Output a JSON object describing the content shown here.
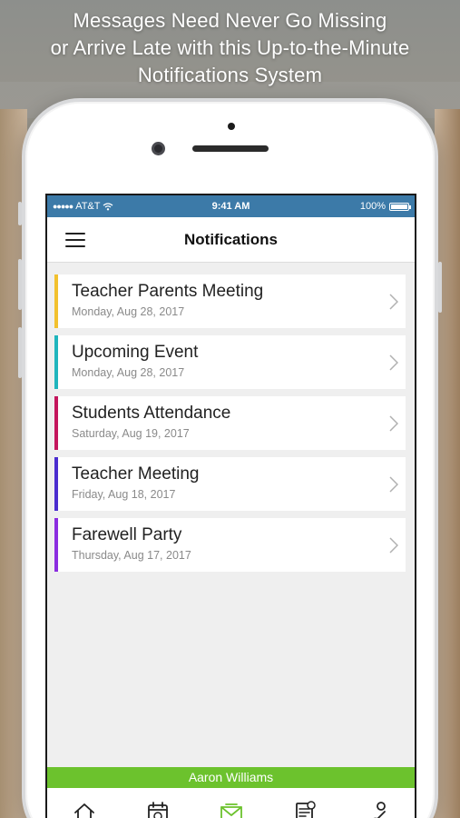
{
  "promo": {
    "line1": "Messages Need Never Go Missing",
    "line2": "or Arrive Late with this Up-to-the-Minute",
    "line3": "Notifications System"
  },
  "status_bar": {
    "carrier": "AT&T",
    "time": "9:41 AM",
    "battery": "100%"
  },
  "navbar": {
    "title": "Notifications",
    "menu_icon": "hamburger-menu-icon"
  },
  "notifications": [
    {
      "title": "Teacher Parents Meeting",
      "date": "Monday, Aug 28, 2017",
      "accent": "#f2c12e"
    },
    {
      "title": "Upcoming Event",
      "date": "Monday, Aug 28, 2017",
      "accent": "#1fb5bd"
    },
    {
      "title": "Students Attendance",
      "date": "Saturday, Aug 19, 2017",
      "accent": "#c4155c"
    },
    {
      "title": "Teacher Meeting",
      "date": "Friday, Aug 18, 2017",
      "accent": "#4a2ccf"
    },
    {
      "title": "Farewell Party",
      "date": "Thursday, Aug 17, 2017",
      "accent": "#8b2de0"
    }
  ],
  "user_bar": {
    "name": "Aaron Williams",
    "color": "#6cc22d"
  },
  "tab_bar": [
    {
      "icon": "home-icon",
      "active": false
    },
    {
      "icon": "calendar-icon",
      "active": false
    },
    {
      "icon": "envelope-icon",
      "active": true
    },
    {
      "icon": "document-icon",
      "active": false
    },
    {
      "icon": "support-icon",
      "active": false
    }
  ],
  "colors": {
    "status_bar": "#3c7aa8",
    "tab_active": "#6cc22d",
    "tab_inactive": "#222222"
  }
}
